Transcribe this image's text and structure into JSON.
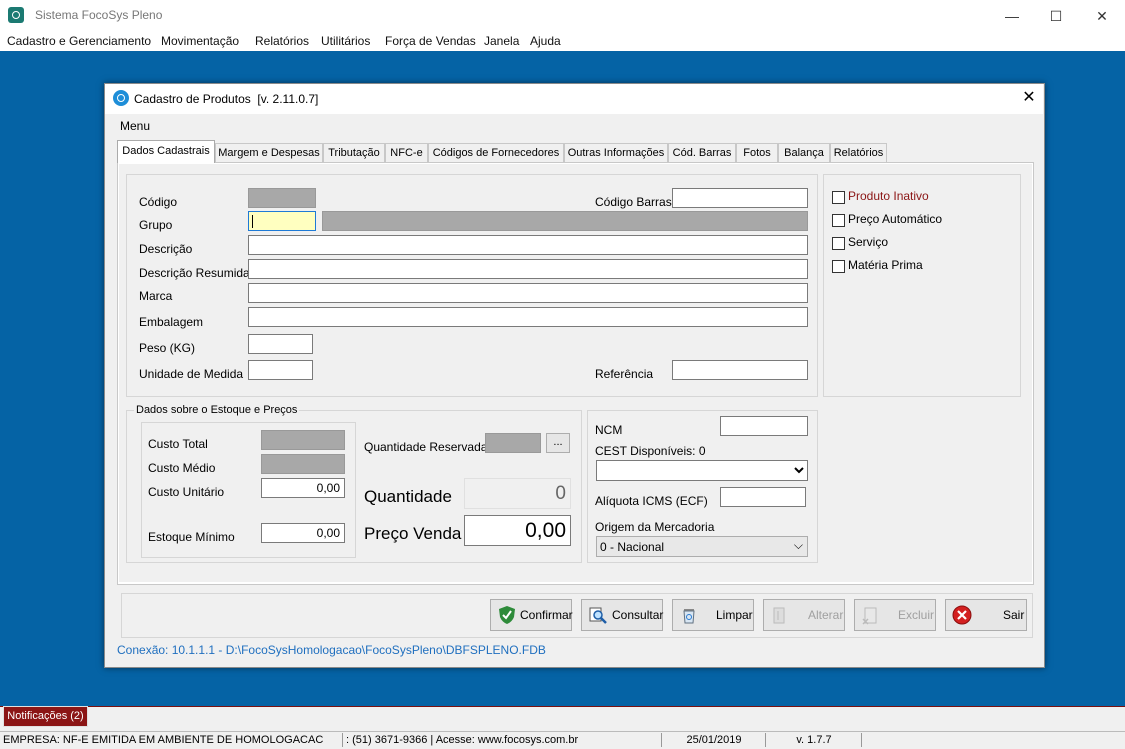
{
  "app": {
    "title": "Sistema FocoSys Pleno",
    "window_buttons": {
      "minimize": "—",
      "maximize": "☐",
      "close": "✕"
    },
    "menu": [
      "Cadastro e Gerenciamento",
      "Movimentação",
      "Relatórios",
      "Utilitários",
      "Força de Vendas",
      "Janela",
      "Ajuda"
    ]
  },
  "dialog": {
    "title": "Cadastro de Produtos",
    "version": "[v. 2.11.0.7]",
    "close": "✕",
    "menu_label": "Menu",
    "tabs": [
      "Dados Cadastrais",
      "Margem e Despesas",
      "Tributação",
      "NFC-e",
      "Códigos de Fornecedores",
      "Outras Informações",
      "Cód. Barras",
      "Fotos",
      "Balança",
      "Relatórios"
    ],
    "fields": {
      "codigo": {
        "label": "Código",
        "value": ""
      },
      "codigo_barras": {
        "label": "Código Barras",
        "value": ""
      },
      "grupo": {
        "label": "Grupo",
        "value": ""
      },
      "descricao": {
        "label": "Descrição",
        "value": ""
      },
      "descricao_resumida": {
        "label": "Descrição Resumida",
        "value": ""
      },
      "marca": {
        "label": "Marca",
        "value": ""
      },
      "embalagem": {
        "label": "Embalagem",
        "value": ""
      },
      "peso": {
        "label": "Peso (KG)",
        "value": ""
      },
      "unidade": {
        "label": "Unidade de Medida",
        "value": ""
      },
      "referencia": {
        "label": "Referência",
        "value": ""
      }
    },
    "checkboxes": [
      {
        "label": "Produto Inativo",
        "checked": false,
        "color": "#8b1515"
      },
      {
        "label": "Preço Automático",
        "checked": false
      },
      {
        "label": "Serviço",
        "checked": false
      },
      {
        "label": "Matéria Prima",
        "checked": false
      }
    ],
    "estoque": {
      "group_title": "Dados sobre o Estoque e Preços",
      "custo_total_label": "Custo Total",
      "custo_medio_label": "Custo Médio",
      "custo_unitario_label": "Custo Unitário",
      "custo_unitario_value": "0,00",
      "estoque_minimo_label": "Estoque Mínimo",
      "estoque_minimo_value": "0,00",
      "qtd_reservada_label": "Quantidade Reservada",
      "ellipsis": "...",
      "quantidade_label": "Quantidade",
      "quantidade_value": "0",
      "preco_venda_label": "Preço Venda",
      "preco_venda_value": "0,00"
    },
    "fiscal": {
      "ncm_label": "NCM",
      "cest_label": "CEST Disponíveis: 0",
      "aliquota_label": "Alíquota ICMS (ECF)",
      "origem_label": "Origem da Mercadoria",
      "origem_value": "0 - Nacional"
    },
    "buttons": {
      "confirmar": "Confirmar",
      "consultar": "Consultar",
      "limpar": "Limpar",
      "alterar": "Alterar",
      "excluir": "Excluir",
      "sair": "Sair"
    },
    "connection": "Conexão: 10.1.1.1 - D:\\FocoSysHomologacao\\FocoSysPleno\\DBFSPLENO.FDB"
  },
  "notifications": "Notificações (2)",
  "statusbar": {
    "empresa": "EMPRESA: NF-E EMITIDA EM AMBIENTE DE HOMOLOGACAC",
    "contact": " : (51) 3671-9366 | Acesse: www.focosys.com.br",
    "date": "25/01/2019",
    "version": "v. 1.7.7"
  },
  "colors": {
    "desktop": "#0563a5",
    "link": "#1f6fbf",
    "accent_red": "#8b1515"
  }
}
